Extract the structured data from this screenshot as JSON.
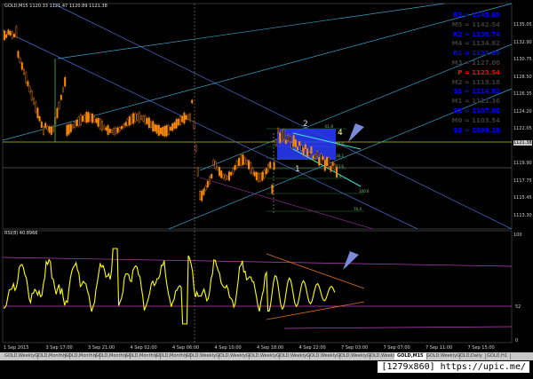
{
  "header": {
    "symbol_line": "GOLD,M15  1120.33 1121.47 1120.89 1121.38"
  },
  "pivots": [
    {
      "label": "R3",
      "value": "1145.69",
      "color": "#0000ff"
    },
    {
      "label": "M5",
      "value": "1142.54",
      "color": "#000000"
    },
    {
      "label": "R2",
      "value": "1138.74",
      "color": "#0000ff"
    },
    {
      "label": "M4",
      "value": "1134.82",
      "color": "#000000"
    },
    {
      "label": "R1",
      "value": "1131.89",
      "color": "#0000ff"
    },
    {
      "label": "M3",
      "value": "1127.00",
      "color": "#000000"
    },
    {
      "label": "P",
      "value": "1123.54",
      "color": "#ff0000"
    },
    {
      "label": "M2",
      "value": "1119.18",
      "color": "#000000"
    },
    {
      "label": "S1",
      "value": "1114.82",
      "color": "#0000ff"
    },
    {
      "label": "M1",
      "value": "1111.36",
      "color": "#000000"
    },
    {
      "label": "S2",
      "value": "1107.00",
      "color": "#0000ff"
    },
    {
      "label": "M0",
      "value": "1103.54",
      "color": "#000000"
    },
    {
      "label": "S3",
      "value": "1099.18",
      "color": "#0000ff"
    }
  ],
  "price_axis": [
    "1135.05",
    "1132.90",
    "1130.75",
    "1128.50",
    "1126.35",
    "1124.20",
    "1122.05",
    "1121.38",
    "1119.90",
    "1117.75",
    "1115.45",
    "1113.30"
  ],
  "rsi_header": "RSI(8) 40.8966",
  "rsi_axis": [
    "100",
    "52",
    "0"
  ],
  "wave_labels": {
    "one": "1",
    "two": "2",
    "four": "4"
  },
  "fib_labels": [
    "61.8",
    "50.0",
    "38.2",
    "23.6",
    "0.0",
    "100.0",
    "76.4"
  ],
  "time_axis": [
    "1 Sep 2015",
    "3 Sep 17:00",
    "3 Sep 21:00",
    "4 Sep 02:00",
    "4 Sep 06:00",
    "4 Sep 10:00",
    "4 Sep 18:00",
    "4 Sep 22:00",
    "7 Sep 03:00",
    "7 Sep 07:00",
    "7 Sep 11:00",
    "7 Sep 15:00"
  ],
  "tabs": [
    "GOLD,Weekly",
    "GOLD,Monthly",
    "GOLD,Monthly",
    "GOLD,Monthly",
    "GOLD,Monthly",
    "GOLD,Monthly",
    "GOLD,Weekly",
    "GOLD,Weekly",
    "GOLD,Weekly",
    "GOLD,Weekly",
    "GOLD,Weekly",
    "GOLD,Weekly",
    "GOLD,Weekly",
    "GOLD,M15",
    "GOLD,Weekly",
    "GOLD,Daily",
    "GOLD,H1"
  ],
  "active_tab_index": 13,
  "watermark": "[1279x860] https://upic.me/",
  "colors": {
    "candle_up": "#ff8c00",
    "rsi_line": "#ffff00",
    "channel_blue": "#4a6fd8",
    "channel_cyan": "#3aa0c8",
    "box_fill": "#2a3cff",
    "pivot_line": "#c8c800",
    "arrow": "#7a8ad8"
  }
}
